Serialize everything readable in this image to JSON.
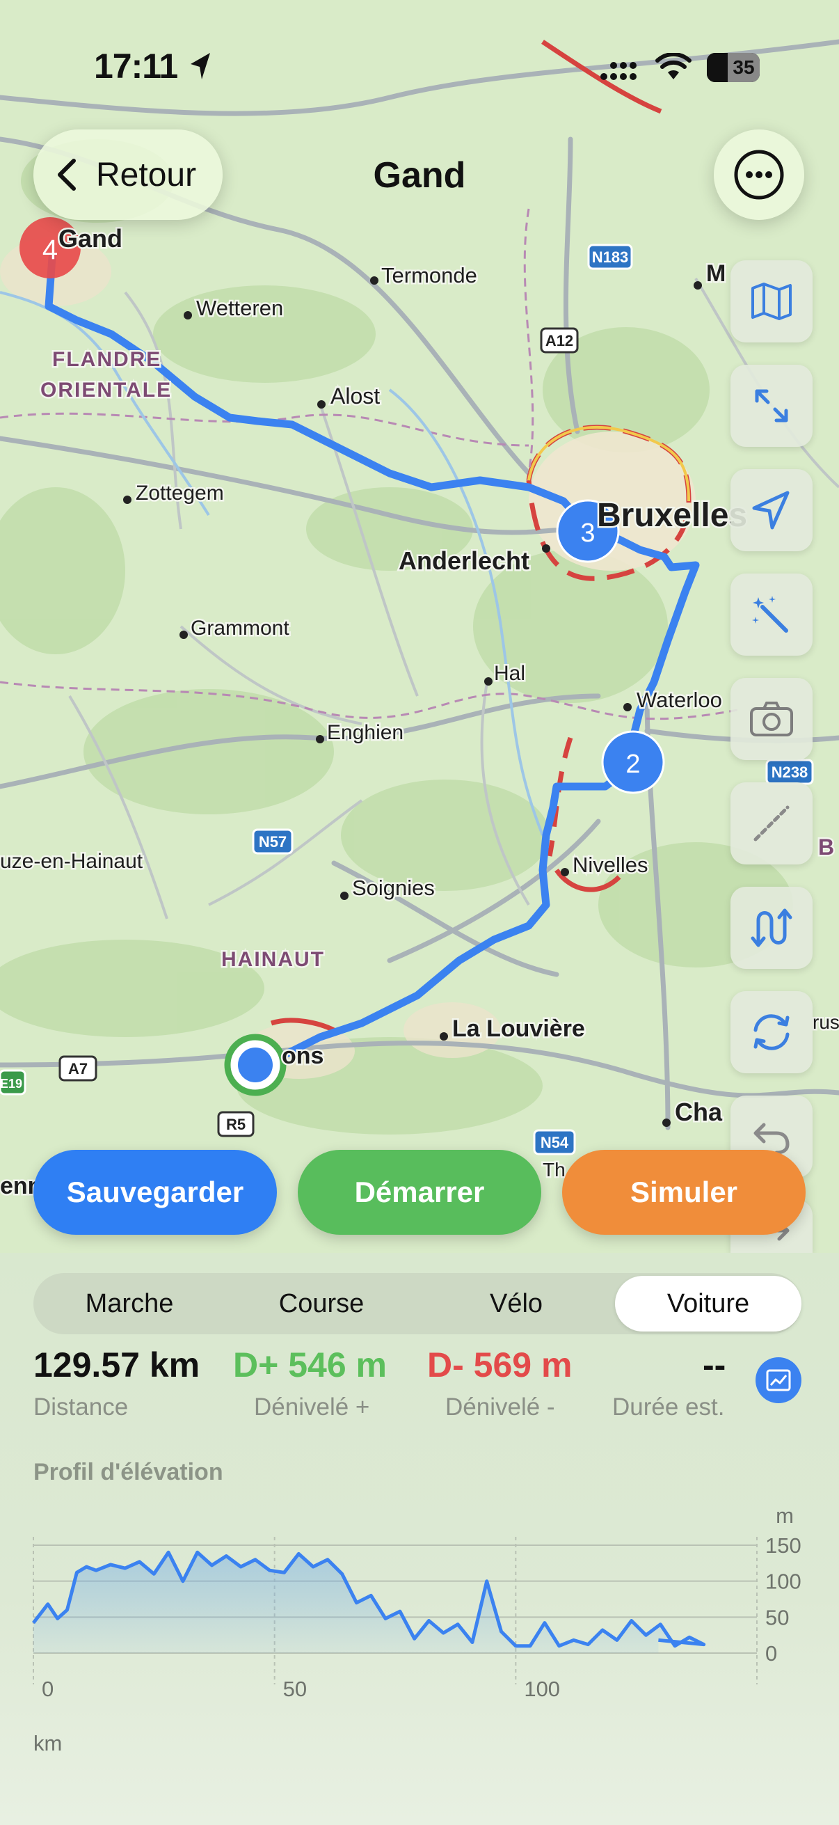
{
  "status_bar": {
    "time": "17:11",
    "battery": "35"
  },
  "header": {
    "back_label": "Retour",
    "title": "Gand"
  },
  "map": {
    "labels": {
      "gand": "Gand",
      "termonde": "Termonde",
      "wetteren": "Wetteren",
      "flandre1": "FLANDRE",
      "flandre2": "ORIENTALE",
      "alost": "Alost",
      "zottegem": "Zottegem",
      "bruxelles": "Bruxelles",
      "anderlecht": "Anderlecht",
      "grammont": "Grammont",
      "hal": "Hal",
      "waterloo": "Waterloo",
      "enghien": "Enghien",
      "nivelles": "Nivelles",
      "braine": "uze-en-Hainaut",
      "soignies": "Soignies",
      "hainaut": "HAINAUT",
      "louviere": "La Louvière",
      "mons": "ons",
      "charleroi": "Cha",
      "m_partial": "M",
      "b_partial": "B",
      "rus_partial": "rus",
      "enn_partial": "enn",
      "th_partial": "Th"
    },
    "road_shields": {
      "n183": "N183",
      "a12": "A12",
      "n57": "N57",
      "n238": "N238",
      "a7": "A7",
      "e19": "E19",
      "r5": "R5",
      "n54": "N54"
    },
    "waypoints": {
      "w2": "2",
      "w3": "3",
      "w4": "4"
    }
  },
  "map_tools": [
    {
      "name": "map-layers-icon"
    },
    {
      "name": "fit-route-icon"
    },
    {
      "name": "locate-icon"
    },
    {
      "name": "magic-wand-icon"
    },
    {
      "name": "camera-icon"
    },
    {
      "name": "measure-line-icon"
    },
    {
      "name": "reverse-route-icon"
    },
    {
      "name": "loop-route-icon"
    },
    {
      "name": "undo-icon"
    },
    {
      "name": "redo-icon"
    }
  ],
  "actions": {
    "save": "Sauvegarder",
    "start": "Démarrer",
    "simulate": "Simuler"
  },
  "modes": {
    "walk": "Marche",
    "run": "Course",
    "bike": "Vélo",
    "car": "Voiture",
    "selected": "Voiture"
  },
  "stats": {
    "distance_value": "129.57 km",
    "distance_label": "Distance",
    "ascent_value": "D+ 546 m",
    "ascent_label": "Dénivelé +",
    "descent_value": "D- 569 m",
    "descent_label": "Dénivelé -",
    "duration_value": "--",
    "duration_label": "Durée est."
  },
  "colors": {
    "route": "#3b82f0",
    "save": "#2f7ff3",
    "start": "#58bd5c",
    "simulate": "#f08d3a",
    "ascent": "#5cbf5c",
    "descent": "#e34a4a",
    "waypoint": "#3b82f0",
    "end_marker": "#e74c4c"
  },
  "chart_data": {
    "type": "area",
    "title": "Profil d'élévation",
    "xlabel": "km",
    "ylabel": "m",
    "xlim": [
      0,
      150
    ],
    "ylim": [
      0,
      150
    ],
    "x_ticks": [
      0,
      50,
      100
    ],
    "y_ticks": [
      0,
      50,
      100,
      150
    ],
    "grid": true,
    "series": [
      {
        "x": [
          0,
          3,
          5,
          7,
          9,
          11,
          13,
          16,
          19,
          22,
          25,
          28,
          31,
          34,
          37,
          40,
          43,
          46,
          49,
          52,
          55,
          58,
          61,
          64,
          67,
          70,
          73,
          76,
          79,
          82,
          85,
          88,
          91,
          94,
          97,
          100,
          103,
          106,
          109,
          112,
          115,
          118,
          121,
          124,
          127,
          130,
          133,
          136,
          139,
          129.57
        ],
        "y": [
          42,
          68,
          48,
          60,
          112,
          120,
          115,
          123,
          118,
          127,
          110,
          140,
          100,
          140,
          122,
          135,
          120,
          130,
          115,
          112,
          138,
          120,
          130,
          110,
          70,
          80,
          48,
          58,
          20,
          45,
          28,
          40,
          15,
          100,
          30,
          10,
          10,
          42,
          10,
          18,
          12,
          32,
          18,
          45,
          25,
          40,
          10,
          22,
          12,
          18
        ]
      }
    ]
  }
}
